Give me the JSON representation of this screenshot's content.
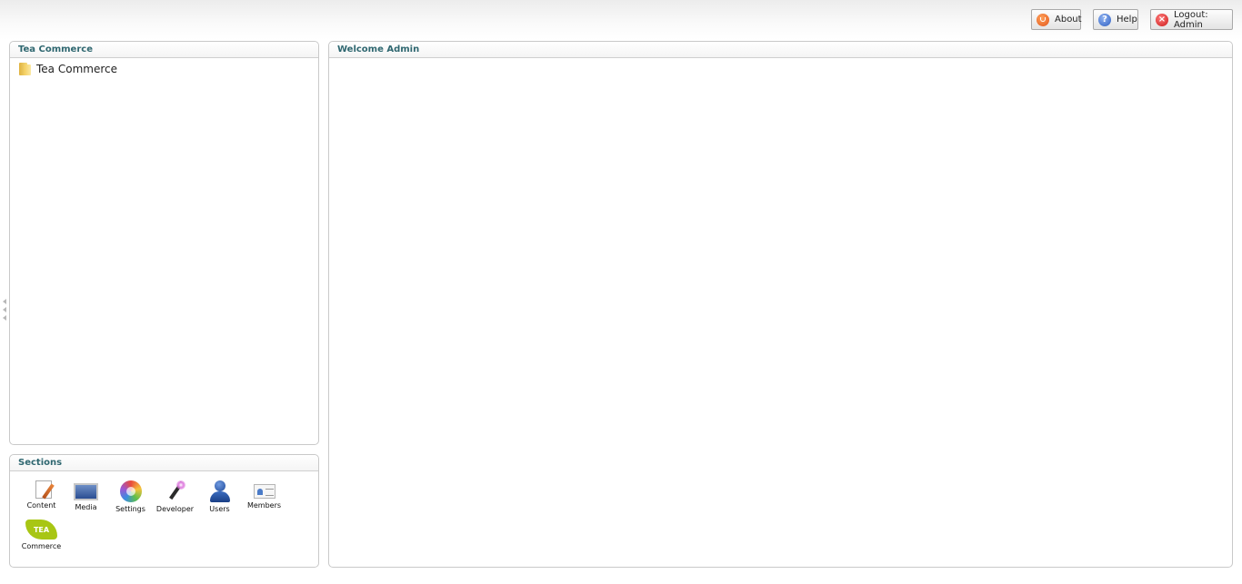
{
  "header": {
    "about_label": "About",
    "help_label": "Help",
    "logout_label": "Logout: Admin"
  },
  "tree_panel": {
    "title": "Tea Commerce",
    "root_node": {
      "label": "Tea Commerce",
      "icon": "folder-icon"
    }
  },
  "sections_panel": {
    "title": "Sections",
    "items": [
      {
        "label": "Content",
        "icon": "content-icon"
      },
      {
        "label": "Media",
        "icon": "media-icon"
      },
      {
        "label": "Settings",
        "icon": "settings-icon"
      },
      {
        "label": "Developer",
        "icon": "developer-icon"
      },
      {
        "label": "Users",
        "icon": "users-icon"
      },
      {
        "label": "Members",
        "icon": "members-icon"
      },
      {
        "label": "Commerce",
        "icon": "tea-commerce-icon",
        "badge_text": "TEA"
      }
    ]
  },
  "main_panel": {
    "title": "Welcome Admin"
  },
  "colors": {
    "panel_title": "#2f6770",
    "tea_commerce_green": "#a8c614",
    "panel_border": "#c9c9c9"
  }
}
